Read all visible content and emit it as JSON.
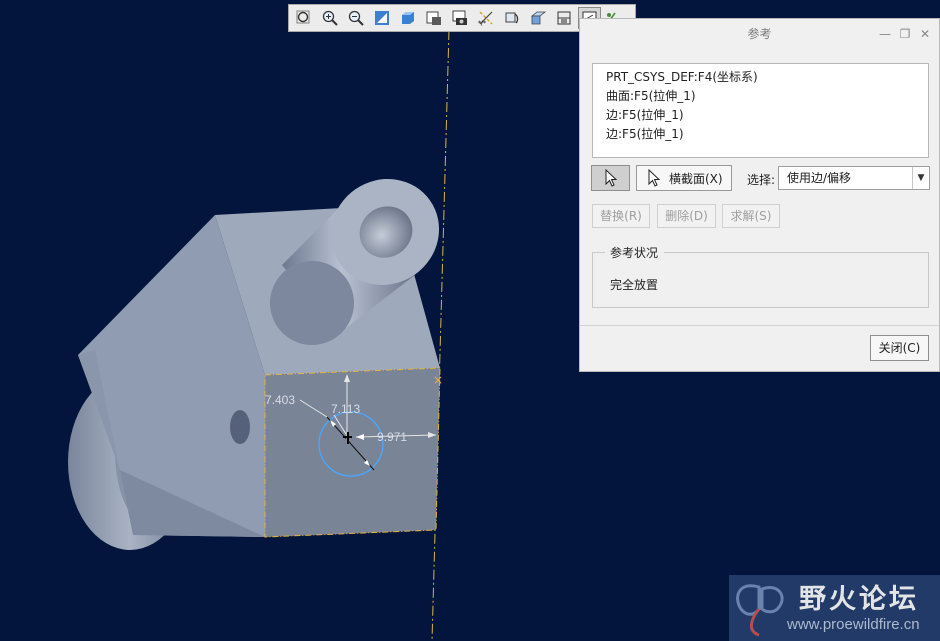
{
  "viewport": {
    "dimensions": {
      "d1": "7.403",
      "d2": "7.113",
      "d3": "9.971"
    }
  },
  "toolbar": {
    "icons": [
      "zoom-fit-icon",
      "zoom-in-icon",
      "zoom-out-icon",
      "repaint-icon",
      "display-style-icon",
      "saved-views-icon",
      "named-view-icon",
      "datum-display-icon",
      "spin-center-icon",
      "annotation-icon",
      "section-view-icon",
      "sketch-view-icon",
      "sketcher-display-icon"
    ]
  },
  "dialog": {
    "title": "参考",
    "references": [
      "PRT_CSYS_DEF:F4(坐标系)",
      "曲面:F5(拉伸_1)",
      "边:F5(拉伸_1)",
      "边:F5(拉伸_1)"
    ],
    "section_button": "横截面(X)",
    "select_label": "选择:",
    "select_value": "使用边/偏移",
    "replace_button": "替换(R)",
    "delete_button": "删除(D)",
    "solve_button": "求解(S)",
    "status_legend": "参考状况",
    "status_text": "完全放置",
    "close_button": "关闭(C)"
  },
  "watermark": {
    "name": "野火论坛",
    "url": "www.proewildfire.cn"
  },
  "colors": {
    "background": "#03153c",
    "model_face": "#8e9bb0",
    "sketch_plane": "#7a8497",
    "reference_line": "#d7b44a",
    "sketch_circle": "#4aa7ff"
  }
}
